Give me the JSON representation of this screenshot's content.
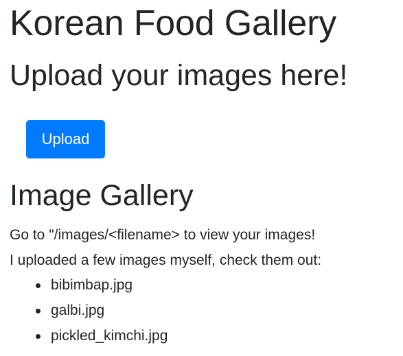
{
  "header": {
    "title": "Korean Food Gallery",
    "upload_heading": "Upload your images here!"
  },
  "upload": {
    "button_label": "Upload",
    "button_color": "#007bff"
  },
  "gallery": {
    "heading": "Image Gallery",
    "instructions": "Go to \"/images/<filename> to view your images!",
    "intro": "I uploaded a few images myself, check them out:",
    "files": [
      "bibimbap.jpg",
      "galbi.jpg",
      "pickled_kimchi.jpg"
    ]
  }
}
